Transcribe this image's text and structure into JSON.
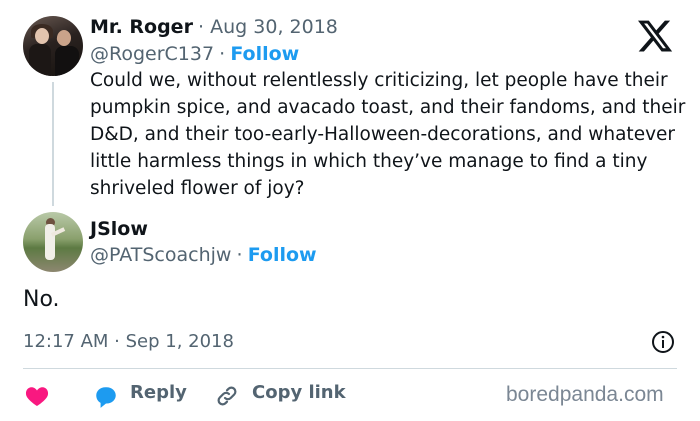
{
  "tweet": {
    "author_name": "Mr. Roger",
    "date": "· Aug 30, 2018",
    "handle": "@RogerC137",
    "separator": "·",
    "follow_label": "Follow",
    "text": "Could we, without relentlessly criticizing, let people have their pumpkin spice, and avacado toast, and their fandoms, and their D&D, and their too-early-Halloween-decorations, and whatever little harmless things in which they’ve manage to find a tiny shriveled flower of joy?"
  },
  "reply": {
    "author_name": "JSlow",
    "handle": "@PATScoachjw",
    "separator": "·",
    "follow_label": "Follow",
    "text": "No.",
    "timestamp": "12:17 AM · Sep 1, 2018"
  },
  "actions": {
    "reply_label": "Reply",
    "copy_link_label": "Copy link"
  },
  "watermark": "boredpanda.com",
  "colors": {
    "accent": "#1d9bf0",
    "heart": "#f91880",
    "muted": "#536471"
  },
  "icons": {
    "brand": "x-logo-icon",
    "info": "info-icon",
    "like": "heart-icon",
    "reply": "reply-bubble-icon",
    "link": "link-icon"
  }
}
